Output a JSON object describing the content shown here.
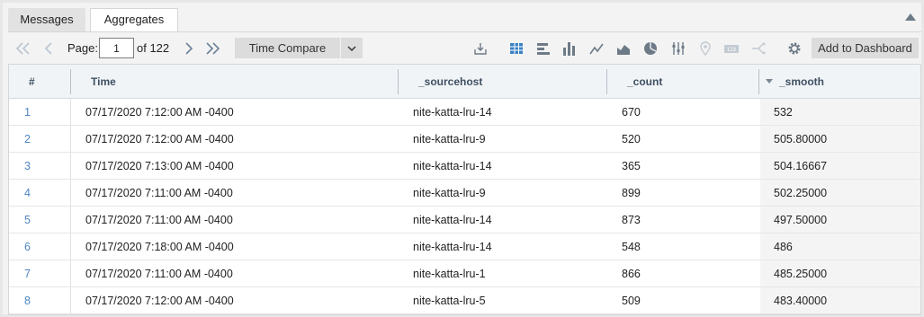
{
  "tabs": [
    {
      "label": "Messages"
    },
    {
      "label": "Aggregates"
    }
  ],
  "toolbar": {
    "page_label": "Page:",
    "page_value": "1",
    "of_label": "of 122",
    "time_compare_label": "Time Compare",
    "add_dashboard_label": "Add to Dashboard",
    "icons": [
      "first-page-icon",
      "prev-page-icon",
      "next-page-icon",
      "last-page-icon",
      "export-icon",
      "table-view-icon",
      "bar-chart-icon",
      "column-chart-icon",
      "line-chart-icon",
      "area-chart-icon",
      "pie-chart-icon",
      "options-icon",
      "map-icon",
      "single-value-icon",
      "combo-icon",
      "gear-icon"
    ]
  },
  "table": {
    "columns": [
      "#",
      "Time",
      "_sourcehost",
      "_count",
      "_smooth"
    ],
    "rows": [
      [
        "1",
        "07/17/2020 7:12:00 AM -0400",
        "nite-katta-lru-14",
        "670",
        "532"
      ],
      [
        "2",
        "07/17/2020 7:12:00 AM -0400",
        "nite-katta-lru-9",
        "520",
        "505.80000"
      ],
      [
        "3",
        "07/17/2020 7:13:00 AM -0400",
        "nite-katta-lru-14",
        "365",
        "504.16667"
      ],
      [
        "4",
        "07/17/2020 7:11:00 AM -0400",
        "nite-katta-lru-9",
        "899",
        "502.25000"
      ],
      [
        "5",
        "07/17/2020 7:11:00 AM -0400",
        "nite-katta-lru-14",
        "873",
        "497.50000"
      ],
      [
        "6",
        "07/17/2020 7:18:00 AM -0400",
        "nite-katta-lru-14",
        "548",
        "486"
      ],
      [
        "7",
        "07/17/2020 7:11:00 AM -0400",
        "nite-katta-lru-1",
        "866",
        "485.25000"
      ],
      [
        "8",
        "07/17/2020 7:12:00 AM -0400",
        "nite-katta-lru-5",
        "509",
        "483.40000"
      ]
    ]
  },
  "colors": {
    "accent_blue": "#3b82c4",
    "header_bg": "#f1f4f7",
    "icon_gray": "#6d7a87"
  }
}
